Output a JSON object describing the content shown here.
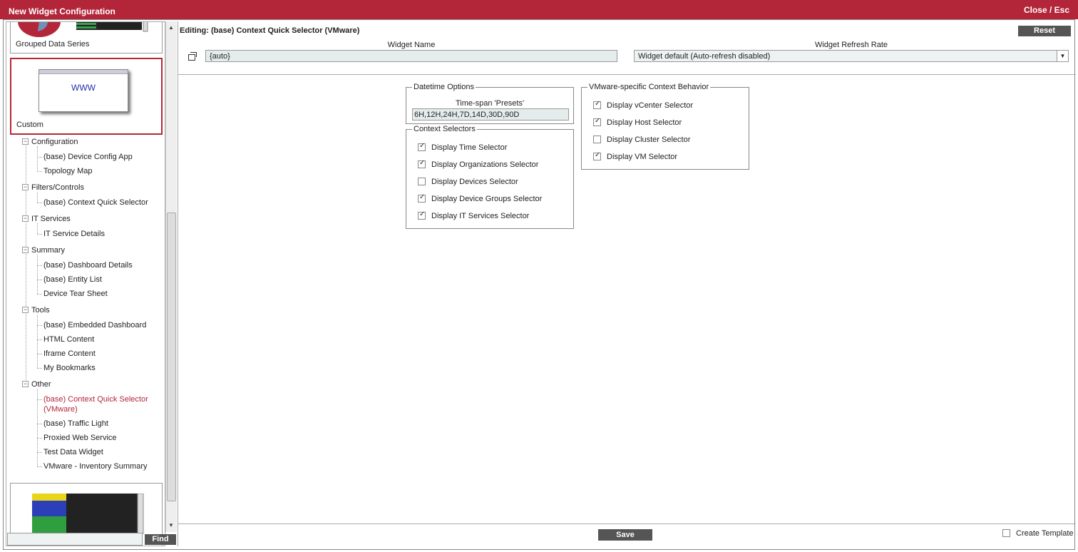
{
  "window": {
    "title": "New Widget Configuration",
    "close_label": "Close / Esc"
  },
  "sidebar": {
    "thumbnails": [
      {
        "label": "Grouped Data Series"
      },
      {
        "label": "Custom",
        "preview_text": "WWW"
      }
    ],
    "tree": [
      {
        "category": "Configuration",
        "items": [
          "(base) Device Config App",
          "Topology Map"
        ]
      },
      {
        "category": "Filters/Controls",
        "items": [
          "(base) Context Quick Selector"
        ]
      },
      {
        "category": "IT Services",
        "items": [
          "IT Service Details"
        ]
      },
      {
        "category": "Summary",
        "items": [
          "(base) Dashboard Details",
          "(base) Entity List",
          "Device Tear Sheet"
        ]
      },
      {
        "category": "Tools",
        "items": [
          "(base) Embedded Dashboard",
          "HTML Content",
          "Iframe Content",
          "My Bookmarks"
        ]
      },
      {
        "category": "Other",
        "items": [
          "(base) Context Quick Selector",
          "(VMware)",
          "(base) Traffic Light",
          "Proxied Web Service",
          "Test Data Widget",
          "VMware - Inventory Summary"
        ]
      }
    ],
    "find_label": "Find",
    "expander_symbol": "−"
  },
  "editor": {
    "editing_title": "Editing: (base) Context Quick Selector (VMware)",
    "reset_label": "Reset",
    "widget_name_label": "Widget Name",
    "widget_name_value": "{auto}",
    "refresh_rate_label": "Widget Refresh Rate",
    "refresh_rate_value": "Widget default (Auto-refresh disabled)",
    "datetime_options": {
      "legend": "Datetime Options",
      "presets_label": "Time-span 'Presets'",
      "presets_value": "6H,12H,24H,7D,14D,30D,90D"
    },
    "context_selectors": {
      "legend": "Context Selectors",
      "items": [
        {
          "label": "Display Time Selector",
          "checked": true
        },
        {
          "label": "Display Organizations Selector",
          "checked": true
        },
        {
          "label": "Display Devices Selector",
          "checked": false
        },
        {
          "label": "Display Device Groups Selector",
          "checked": true
        },
        {
          "label": "Display IT Services Selector",
          "checked": true
        }
      ]
    },
    "vmware_behavior": {
      "legend": "VMware-specific Context Behavior",
      "items": [
        {
          "label": "Display vCenter Selector",
          "checked": true
        },
        {
          "label": "Display Host Selector",
          "checked": true
        },
        {
          "label": "Display Cluster Selector",
          "checked": false
        },
        {
          "label": "Display VM Selector",
          "checked": true
        }
      ]
    },
    "save_label": "Save",
    "create_template_label": "Create Template"
  },
  "colors": {
    "brand": "#b3263a",
    "button": "#555555",
    "input_bg": "#e4ecec"
  }
}
